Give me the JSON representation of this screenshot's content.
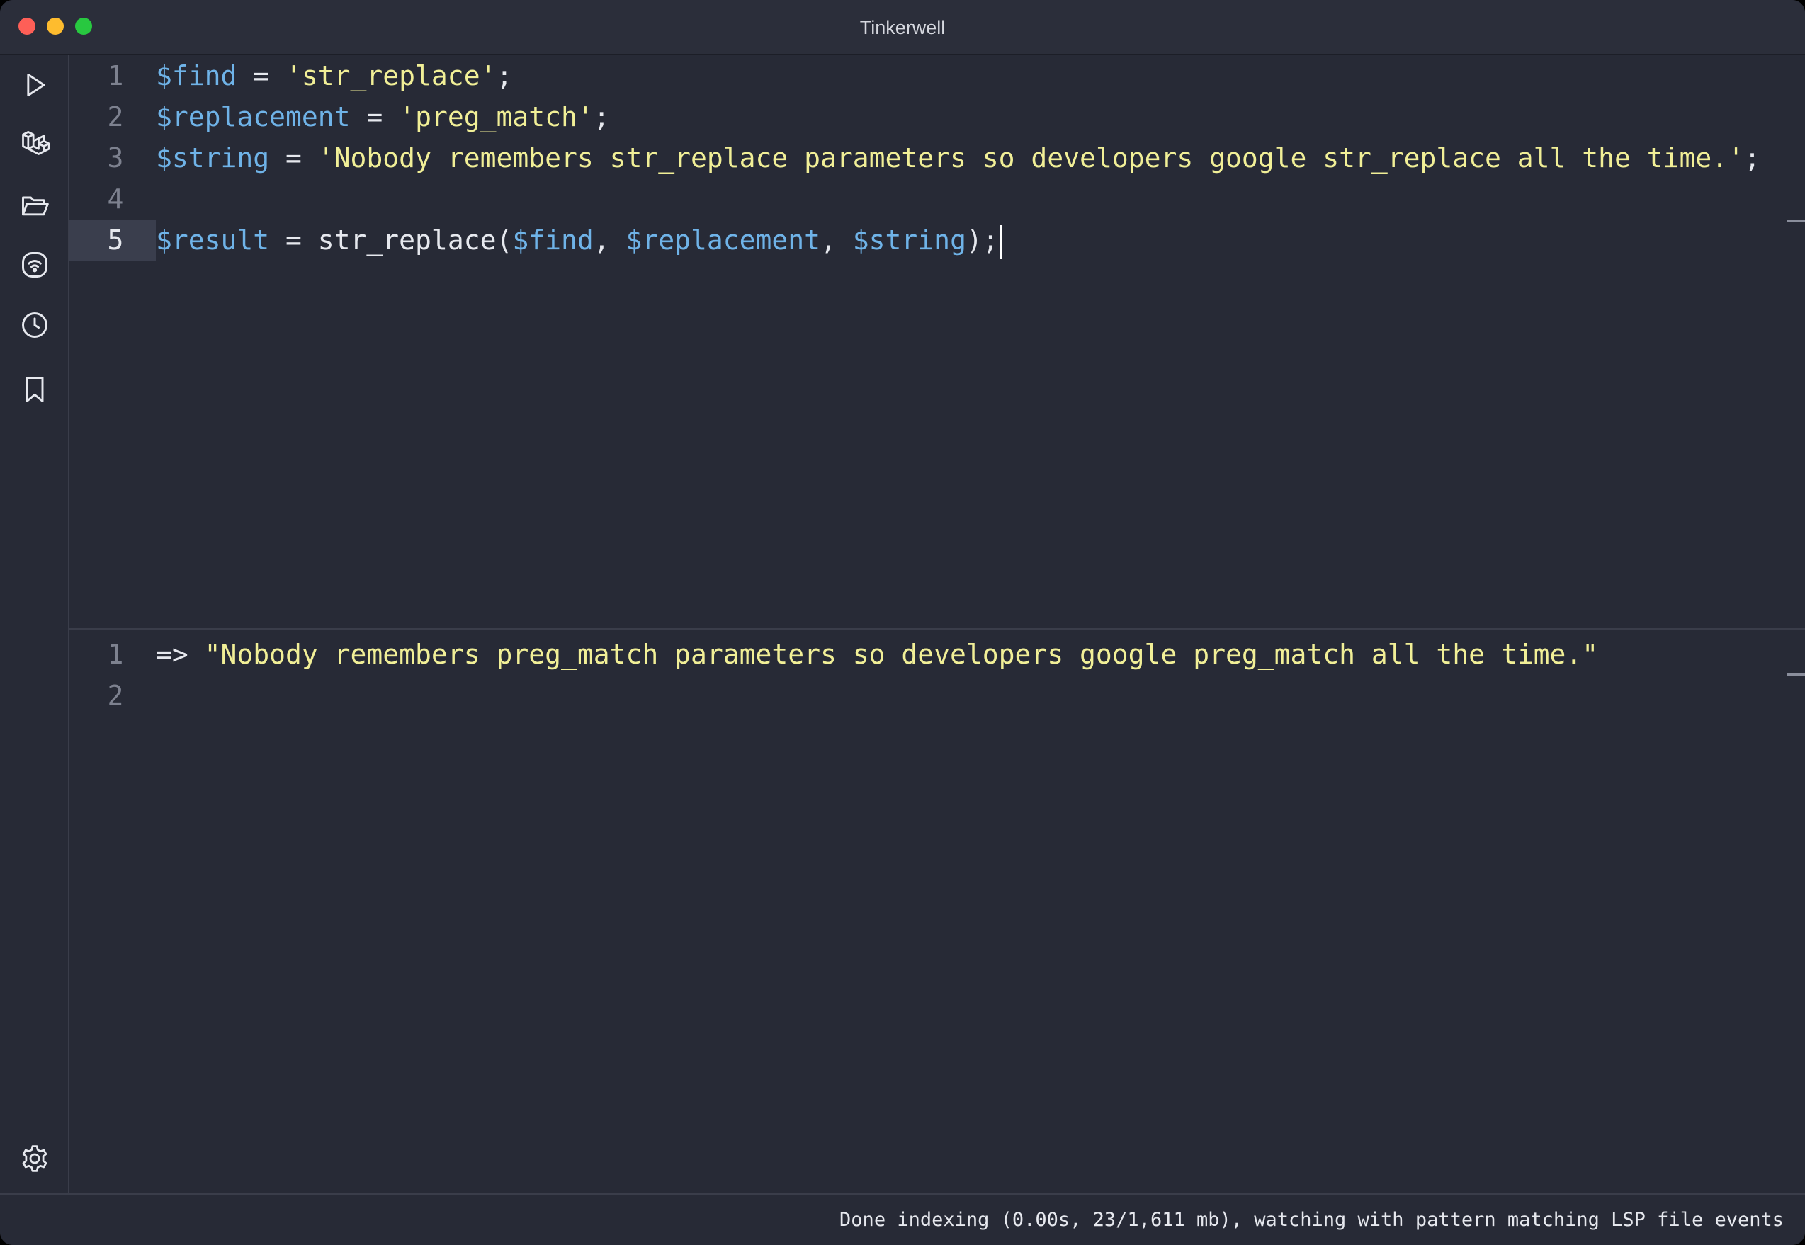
{
  "window": {
    "title": "Tinkerwell"
  },
  "sidebar": {
    "items": [
      {
        "icon": "play-icon",
        "name": "run"
      },
      {
        "icon": "laravel-icon",
        "name": "laravel"
      },
      {
        "icon": "folder-open-icon",
        "name": "open-folder"
      },
      {
        "icon": "remote-connection-icon",
        "name": "remote"
      },
      {
        "icon": "clock-icon",
        "name": "history"
      },
      {
        "icon": "bookmark-icon",
        "name": "snippets"
      }
    ],
    "bottom": {
      "icon": "gear-icon",
      "name": "settings"
    }
  },
  "editor": {
    "lines": [
      {
        "n": "1",
        "tokens": [
          {
            "t": "$find",
            "c": "var"
          },
          {
            "t": " = ",
            "c": "plain"
          },
          {
            "t": "'str_replace'",
            "c": "str"
          },
          {
            "t": ";",
            "c": "plain"
          }
        ]
      },
      {
        "n": "2",
        "tokens": [
          {
            "t": "$replacement",
            "c": "var"
          },
          {
            "t": " = ",
            "c": "plain"
          },
          {
            "t": "'preg_match'",
            "c": "str"
          },
          {
            "t": ";",
            "c": "plain"
          }
        ]
      },
      {
        "n": "3",
        "tokens": [
          {
            "t": "$string",
            "c": "var"
          },
          {
            "t": " = ",
            "c": "plain"
          },
          {
            "t": "'Nobody remembers str_replace parameters so developers google str_replace all the time.'",
            "c": "str"
          },
          {
            "t": ";",
            "c": "plain"
          }
        ]
      },
      {
        "n": "4",
        "tokens": []
      },
      {
        "n": "5",
        "active": true,
        "tokens": [
          {
            "t": "$result",
            "c": "var"
          },
          {
            "t": " = str_replace(",
            "c": "plain"
          },
          {
            "t": "$find",
            "c": "var"
          },
          {
            "t": ", ",
            "c": "plain"
          },
          {
            "t": "$replacement",
            "c": "var"
          },
          {
            "t": ", ",
            "c": "plain"
          },
          {
            "t": "$string",
            "c": "var"
          },
          {
            "t": ");",
            "c": "plain"
          }
        ]
      }
    ]
  },
  "output": {
    "lines": [
      {
        "n": "1",
        "tokens": [
          {
            "t": "=> ",
            "c": "plain"
          },
          {
            "t": "\"Nobody remembers preg_match parameters so developers google preg_match all the time.\"",
            "c": "str"
          }
        ]
      },
      {
        "n": "2",
        "tokens": []
      }
    ]
  },
  "status": {
    "text": "Done indexing (0.00s, 23/1,611 mb), watching with pattern matching LSP file events"
  }
}
